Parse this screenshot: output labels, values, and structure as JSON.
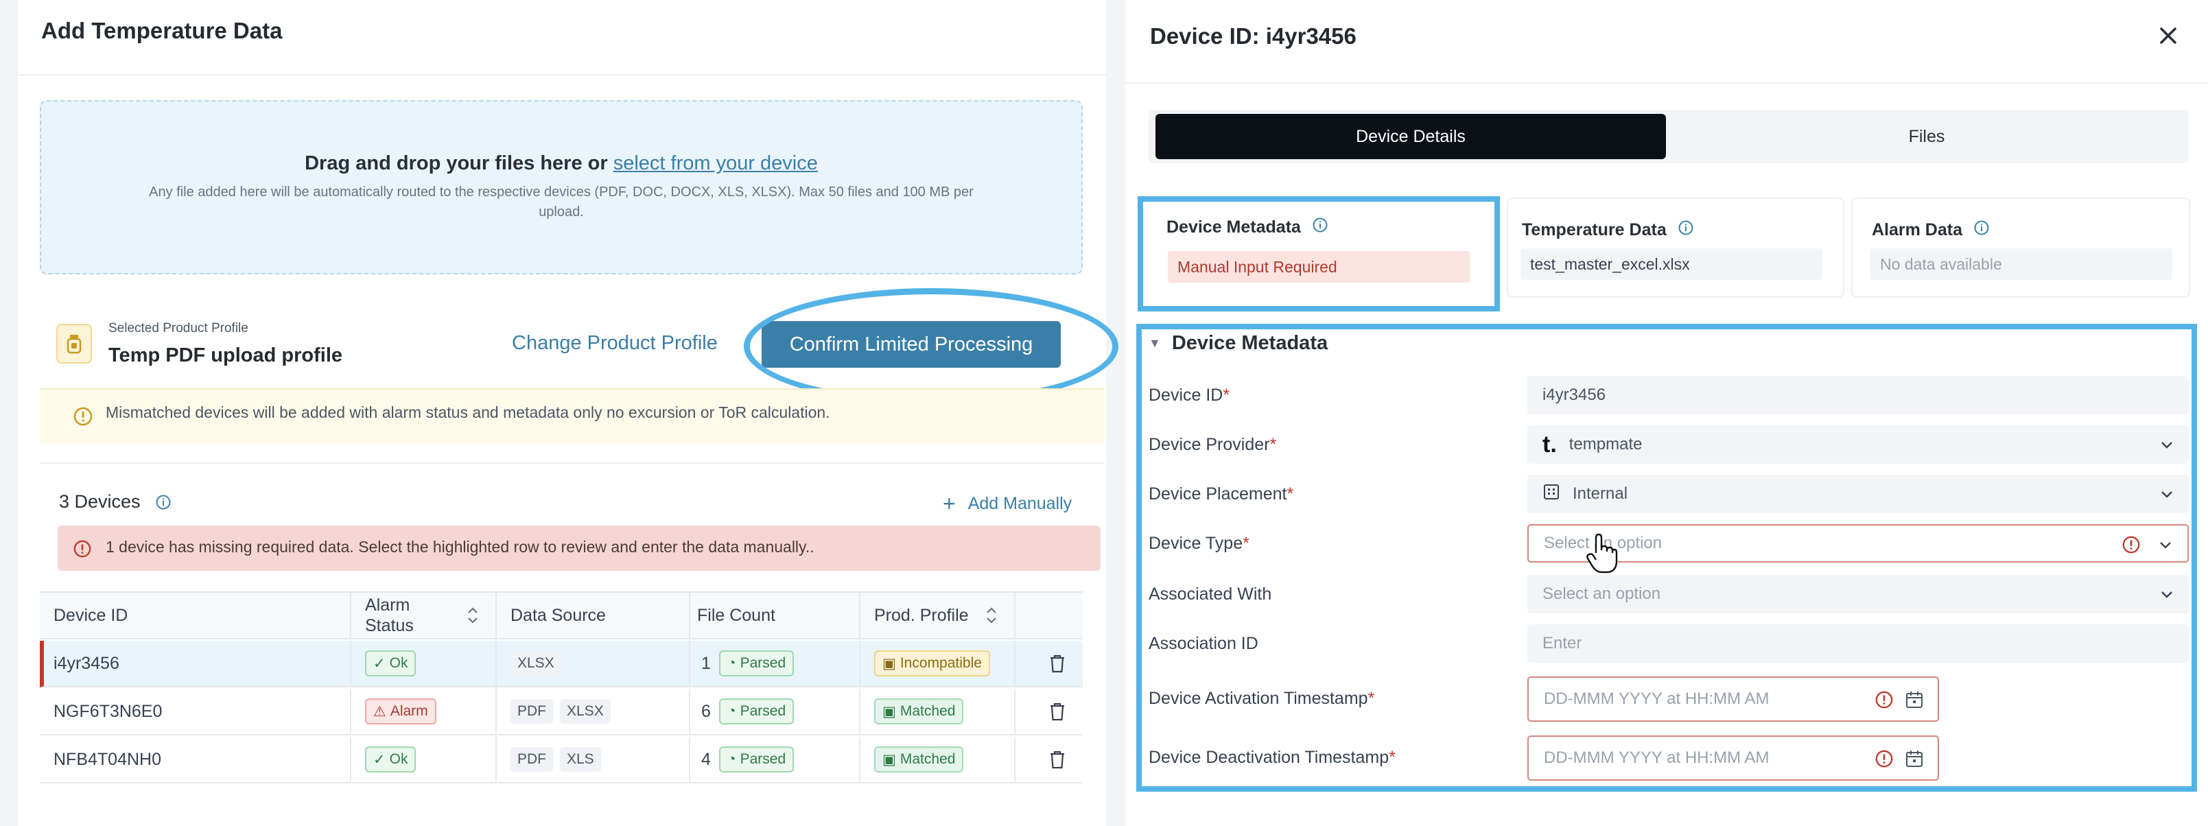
{
  "left": {
    "title": "Add Temperature Data",
    "dropzone": {
      "main": "Drag and drop your files here or ",
      "link": "select from your device",
      "sub": "Any file added here will be automatically routed to the respective devices (PDF, DOC, DOCX, XLS, XLSX). Max 50 files and 100 MB per upload."
    },
    "profile": {
      "caption": "Selected Product Profile",
      "name": "Temp PDF upload profile",
      "change_label": "Change Product Profile",
      "confirm_label": "Confirm Limited Processing"
    },
    "mismatch_note": "Mismatched devices will be added with alarm status and metadata only no excursion or ToR calculation.",
    "devices": {
      "count_label": "3 Devices",
      "add_manually": "Add Manually",
      "alert": "1 device has missing required data. Select the highlighted row to review and enter the data manually.."
    },
    "table": {
      "headers": {
        "device_id": "Device ID",
        "alarm_status_1": "Alarm",
        "alarm_status_2": "Status",
        "data_source": "Data Source",
        "file_count": "File Count",
        "prod_profile": "Prod. Profile"
      },
      "rows": [
        {
          "device_id": "i4yr3456",
          "alarm": "Ok",
          "sources": [
            "XLSX"
          ],
          "count": "1",
          "parsed": "Parsed",
          "profile": "Incompatible"
        },
        {
          "device_id": "NGF6T3N6E0",
          "alarm": "Alarm",
          "sources": [
            "PDF",
            "XLSX"
          ],
          "count": "6",
          "parsed": "Parsed",
          "profile": "Matched"
        },
        {
          "device_id": "NFB4T04NH0",
          "alarm": "Ok",
          "sources": [
            "PDF",
            "XLS"
          ],
          "count": "4",
          "parsed": "Parsed",
          "profile": "Matched"
        }
      ]
    }
  },
  "right": {
    "title": "Device ID: i4yr3456",
    "tabs": {
      "details": "Device Details",
      "files": "Files"
    },
    "cards": {
      "meta": {
        "title": "Device Metadata",
        "value": "Manual Input Required"
      },
      "temp": {
        "title": "Temperature Data",
        "value": "test_master_excel.xlsx"
      },
      "alarm": {
        "title": "Alarm Data",
        "value": "No data available"
      }
    },
    "section_title": "Device Metadata",
    "fields": {
      "device_id": {
        "label": "Device ID",
        "value": "i4yr3456"
      },
      "provider": {
        "label": "Device Provider",
        "value": "tempmate"
      },
      "placement": {
        "label": "Device Placement",
        "value": "Internal"
      },
      "type": {
        "label": "Device Type",
        "placeholder": "Select an option"
      },
      "associated": {
        "label": "Associated With",
        "placeholder": "Select an option"
      },
      "assoc_id": {
        "label": "Association ID",
        "placeholder": "Enter"
      },
      "activation": {
        "label": "Device Activation Timestamp",
        "placeholder": "DD-MMM YYYY at HH:MM AM"
      },
      "deactivation": {
        "label": "Device Deactivation Timestamp",
        "placeholder": "DD-MMM YYYY at HH:MM AM"
      }
    },
    "required_mark": "*"
  },
  "colors": {
    "accent": "#3a7fa8",
    "highlight": "#54b3e6",
    "error": "#c0392b",
    "tab_active": "#0b1017"
  }
}
